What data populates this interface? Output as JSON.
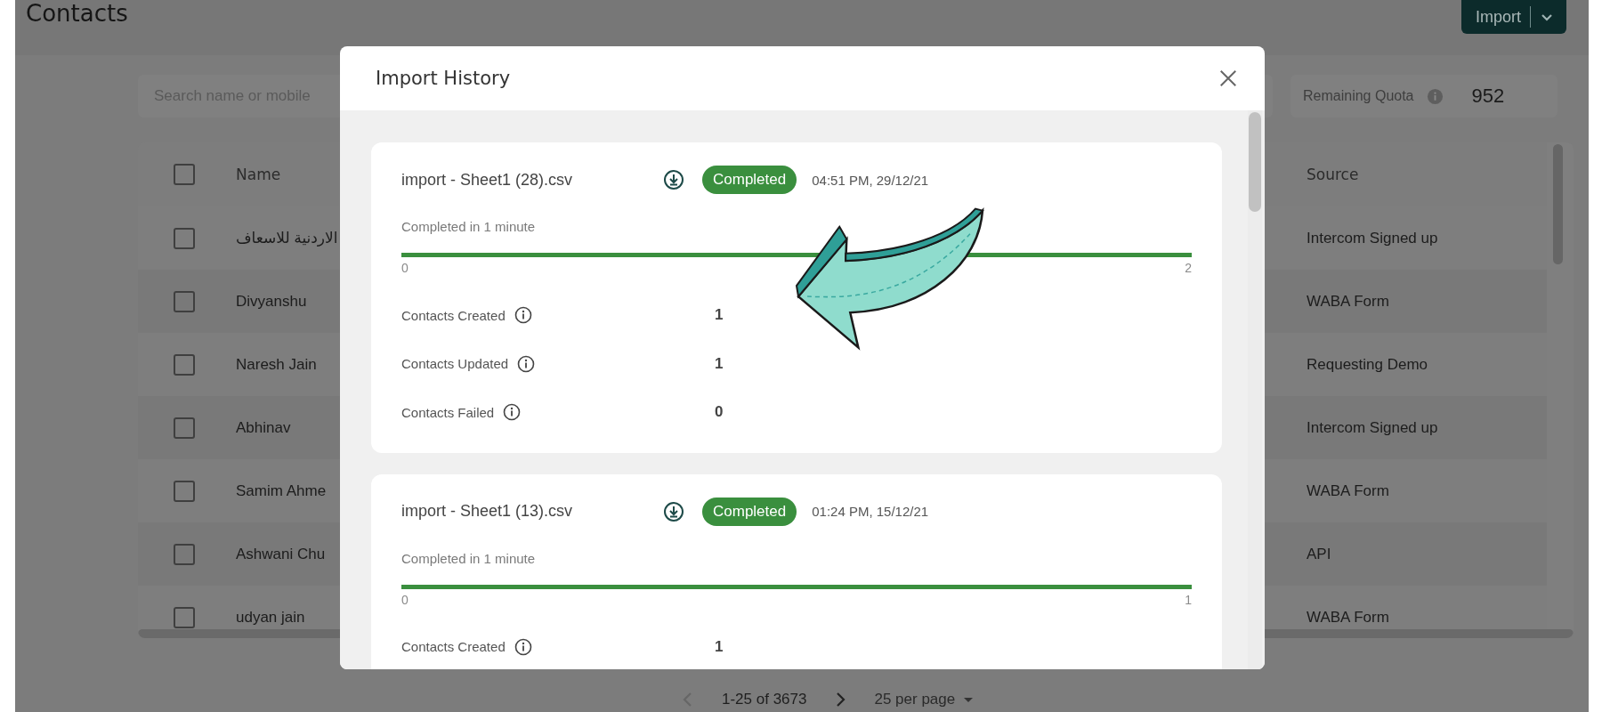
{
  "page": {
    "title": "Contacts",
    "import_button": "Import"
  },
  "search": {
    "placeholder": "Search name or mobile"
  },
  "quota": {
    "label": "Remaining Quota",
    "value": "952"
  },
  "table": {
    "header": {
      "checked": false,
      "columns": [
        "Name",
        "Source"
      ]
    },
    "rows": [
      {
        "name": "الاردنية للاسعاف",
        "source": "Intercom Signed up",
        "checked": false
      },
      {
        "name": "Divyanshu",
        "source": "WABA Form",
        "checked": false
      },
      {
        "name": "Naresh Jain",
        "source": "Requesting Demo",
        "checked": false
      },
      {
        "name": "Abhinav",
        "source": "Intercom Signed up",
        "checked": false
      },
      {
        "name": "Samim Ahme",
        "source": "WABA Form",
        "checked": false
      },
      {
        "name": "Ashwani Chu",
        "source": "API",
        "checked": false
      },
      {
        "name": "udyan jain",
        "source": "WABA Form",
        "checked": false
      }
    ]
  },
  "pagination": {
    "range": "1-25 of 3673",
    "per_page": "25 per page"
  },
  "modal": {
    "title": "Import History",
    "imports": [
      {
        "file": "import - Sheet1 (28).csv",
        "status": "Completed",
        "kind": "completed",
        "time": "04:51 PM, 29/12/21",
        "duration": "Completed in 1 minute",
        "level": 1,
        "scale_min": "0",
        "scale_max": "2",
        "stats": [
          {
            "label": "Contacts Created",
            "value": "1"
          },
          {
            "label": "Contacts Updated",
            "value": "1"
          },
          {
            "label": "Contacts Failed",
            "value": "0"
          }
        ]
      },
      {
        "file": "import - Sheet1 (13).csv",
        "status": "Completed",
        "kind": "completed",
        "time": "01:24 PM, 15/12/21",
        "duration": "Completed in 1 minute",
        "level": 1,
        "scale_min": "0",
        "scale_max": "1",
        "stats": [
          {
            "label": "Contacts Created",
            "value": "1"
          }
        ]
      }
    ]
  }
}
